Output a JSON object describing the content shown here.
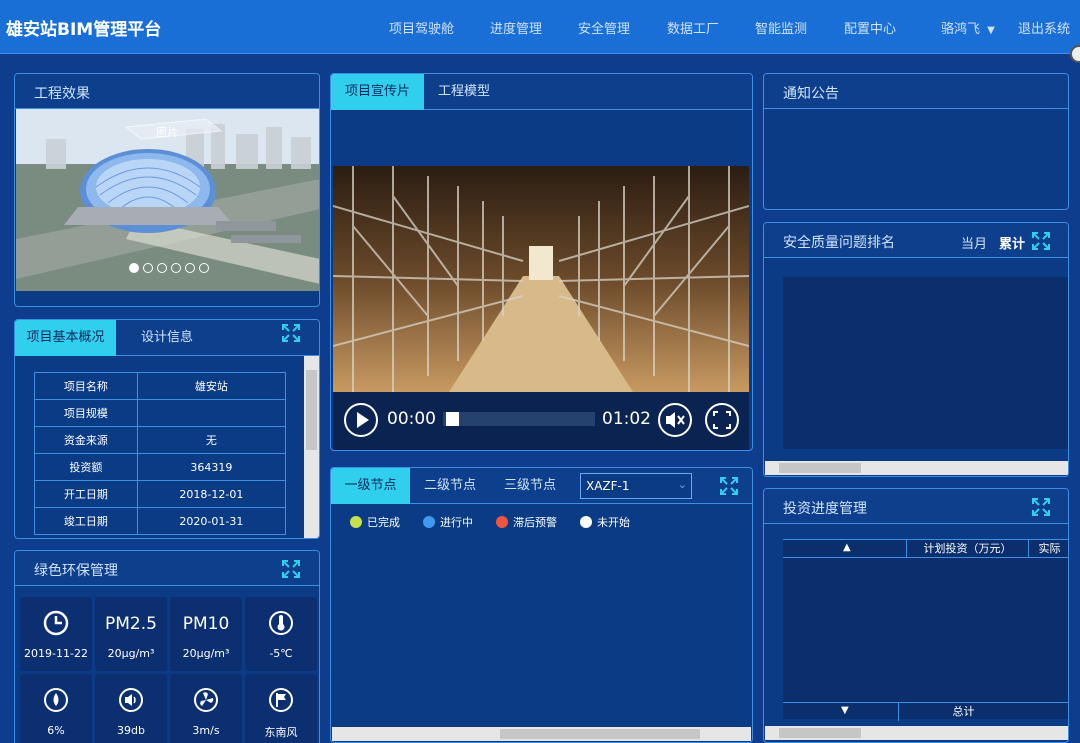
{
  "header": {
    "title": "雄安站BIM管理平台",
    "nav": [
      "项目驾驶舱",
      "进度管理",
      "安全管理",
      "数据工厂",
      "智能监测",
      "配置中心"
    ],
    "user": "骆鸿飞",
    "logout": "退出系统"
  },
  "effect": {
    "title": "工程效果",
    "image_label": "图片",
    "slide_count": 6,
    "active_slide": 1
  },
  "overview": {
    "tabs": [
      "项目基本概况",
      "设计信息"
    ],
    "rows": [
      {
        "k": "项目名称",
        "v": "雄安站"
      },
      {
        "k": "项目规模",
        "v": ""
      },
      {
        "k": "资金来源",
        "v": "无"
      },
      {
        "k": "投资额",
        "v": "364319"
      },
      {
        "k": "开工日期",
        "v": "2018-12-01"
      },
      {
        "k": "竣工日期",
        "v": "2020-01-31"
      }
    ]
  },
  "env": {
    "title": "绿色环保管理",
    "cells": [
      {
        "icon": "clock-icon",
        "big": "",
        "value": "2019-11-22"
      },
      {
        "icon": "",
        "big": "PM2.5",
        "value": "20μg/m³"
      },
      {
        "icon": "",
        "big": "PM10",
        "value": "20μg/m³"
      },
      {
        "icon": "thermometer-icon",
        "big": "",
        "value": "-5℃"
      },
      {
        "icon": "humidity-icon",
        "big": "",
        "value": "6%"
      },
      {
        "icon": "speaker-icon",
        "big": "",
        "value": "39db"
      },
      {
        "icon": "fan-icon",
        "big": "",
        "value": "3m/s"
      },
      {
        "icon": "flag-icon",
        "big": "",
        "value": "东南风"
      }
    ]
  },
  "video": {
    "tabs": [
      "项目宣传片",
      "工程模型"
    ],
    "current": "00:00",
    "duration": "01:02",
    "progress": 0.02
  },
  "nodes": {
    "tabs": [
      "一级节点",
      "二级节点",
      "三级节点"
    ],
    "select": "XAZF-1",
    "legend": [
      {
        "label": "已完成",
        "color": "#c8e04a"
      },
      {
        "label": "进行中",
        "color": "#3f9af0"
      },
      {
        "label": "滞后预警",
        "color": "#f0553f"
      },
      {
        "label": "未开始",
        "color": "#ffffff"
      }
    ]
  },
  "notice": {
    "title": "通知公告"
  },
  "quality": {
    "title": "安全质量问题排名",
    "options": [
      "当月",
      "累计"
    ],
    "active_option": "累计"
  },
  "invest": {
    "title": "投资进度管理",
    "col_planned": "计划投资（万元）",
    "col_actual": "实际",
    "total": "总计"
  }
}
